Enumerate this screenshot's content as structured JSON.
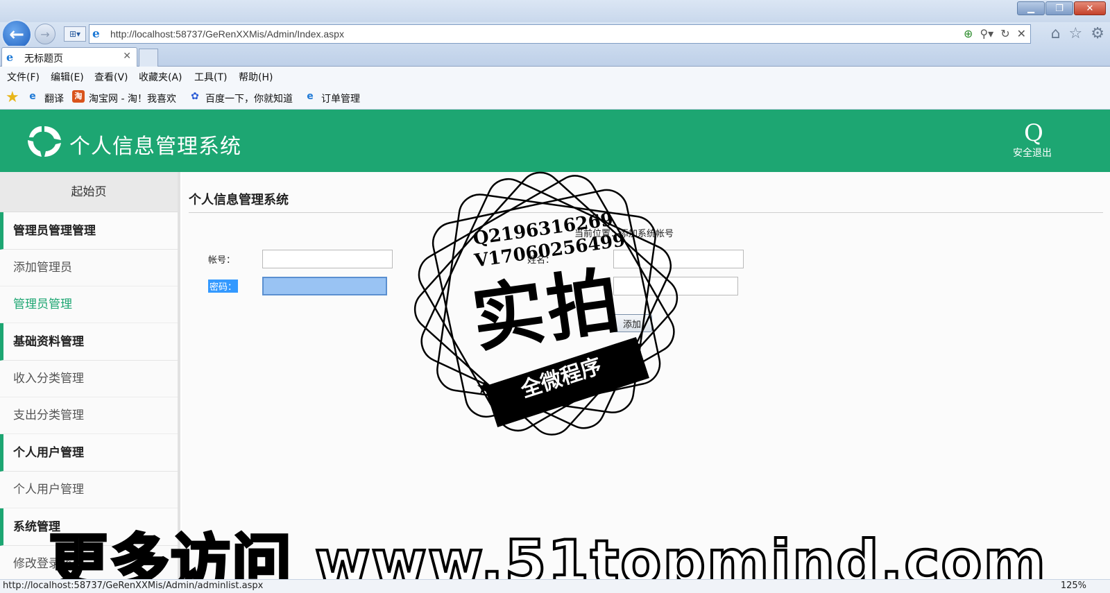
{
  "browser": {
    "url": "http://localhost:58737/GeRenXXMis/Admin/Index.aspx",
    "tab_title": "无标题页",
    "window_buttons": [
      "▁",
      "❐",
      "✕"
    ],
    "menu": [
      "文件(F)",
      "编辑(E)",
      "查看(V)",
      "收藏夹(A)",
      "工具(T)",
      "帮助(H)"
    ],
    "favorites": [
      "翻译",
      "淘宝网 - 淘！我喜欢",
      "百度一下，你就知道",
      "订单管理"
    ],
    "status_url": "http://localhost:58737/GeRenXXMis/Admin/adminlist.aspx",
    "zoom": "125%"
  },
  "header": {
    "title": "个人信息管理系统",
    "logout_icon": "Q",
    "logout_label": "安全退出",
    "color": "#1da672"
  },
  "sidebar": {
    "home": "起始页",
    "groups": [
      {
        "label": "管理员管理管理",
        "items": [
          {
            "label": "添加管理员",
            "active": false
          },
          {
            "label": "管理员管理",
            "active": true
          }
        ]
      },
      {
        "label": "基础资料管理",
        "items": [
          {
            "label": "收入分类管理",
            "active": false
          },
          {
            "label": "支出分类管理",
            "active": false
          }
        ]
      },
      {
        "label": "个人用户管理",
        "items": [
          {
            "label": "个人用户管理",
            "active": false
          }
        ]
      },
      {
        "label": "系统管理",
        "items": [
          {
            "label": "修改登录密码",
            "active": false
          }
        ]
      }
    ]
  },
  "main": {
    "title": "个人信息管理系统",
    "location": "当前位置：添加系统帐号",
    "account_label": "帐号：",
    "password_label": "密码：",
    "name_label": "姓名：",
    "add_button": "添加"
  },
  "overlay": {
    "stamp_q": "Q2196316269",
    "stamp_v": "V17060256499",
    "stamp_main": "实拍",
    "stamp_band": "全微程序",
    "watermark": "更多访问 www.51topmind.com"
  }
}
